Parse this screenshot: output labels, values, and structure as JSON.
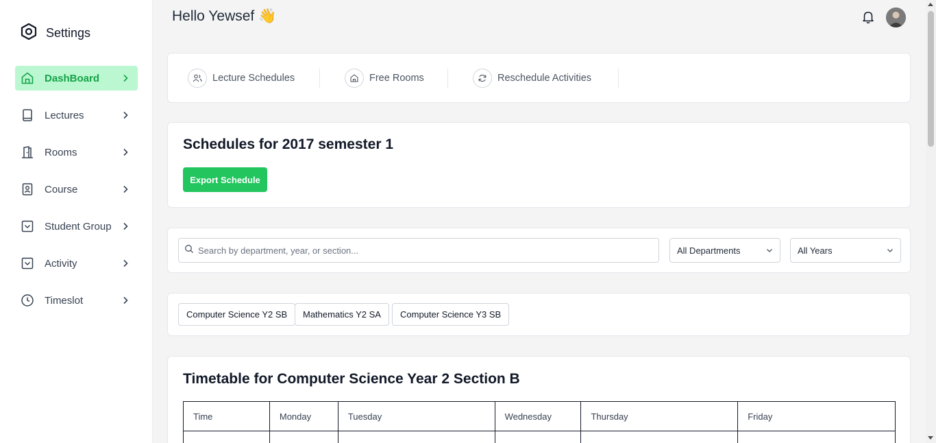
{
  "sidebar": {
    "brand": {
      "label": "Settings",
      "icon": "settings-icon"
    },
    "items": [
      {
        "label": "DashBoard",
        "icon": "home-icon",
        "active": true
      },
      {
        "label": "Lectures",
        "icon": "book-icon"
      },
      {
        "label": "Rooms",
        "icon": "door-icon"
      },
      {
        "label": "Course",
        "icon": "contact-book-icon"
      },
      {
        "label": "Student Group",
        "icon": "check-square-icon"
      },
      {
        "label": "Activity",
        "icon": "check-square-icon"
      },
      {
        "label": "Timeslot",
        "icon": "clock-icon"
      }
    ]
  },
  "header": {
    "greeting": "Hello Yewsef 👋"
  },
  "tabs": [
    {
      "label": "Lecture Schedules",
      "icon": "users-icon"
    },
    {
      "label": "Free Rooms",
      "icon": "home-icon"
    },
    {
      "label": "Reschedule Activities",
      "icon": "refresh-icon"
    }
  ],
  "schedule": {
    "title": "Schedules for 2017 semester 1",
    "export_label": "Export Schedule"
  },
  "filters": {
    "search_placeholder": "Search by department, year, or section...",
    "department": "All Departments",
    "year": "All Years"
  },
  "groups": [
    "Computer Science Y2 SB",
    "Mathematics Y2 SA",
    "Computer Science Y3 SB"
  ],
  "timetable": {
    "title": "Timetable for Computer Science Year 2 Section B",
    "columns": [
      "Time",
      "Monday",
      "Tuesday",
      "Wednesday",
      "Thursday",
      "Friday"
    ]
  },
  "colors": {
    "accent": "#22c55e",
    "active_bg": "#bbf7d0",
    "active_text": "#16a34a"
  }
}
